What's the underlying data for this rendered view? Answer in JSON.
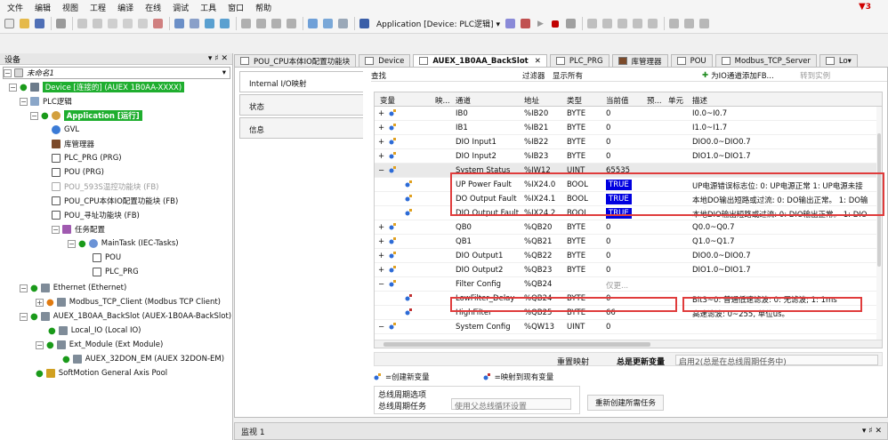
{
  "menu": [
    "文件",
    "编辑",
    "视图",
    "工程",
    "编译",
    "在线",
    "调试",
    "工具",
    "窗口",
    "帮助"
  ],
  "alarm_count": "3",
  "toolbar": {
    "app_combo": "Application [Device: PLC逻辑]"
  },
  "devices_pane": {
    "title": "设备",
    "controls": "▾ ♯ ✕",
    "project": "未命名1",
    "items": [
      {
        "label": "Device [连接的] (AUEX 1B0AA-XXXX)"
      },
      {
        "label": "PLC逻辑"
      },
      {
        "label": "Application [运行]"
      },
      {
        "label": "GVL"
      },
      {
        "label": "库管理器"
      },
      {
        "label": "PLC_PRG (PRG)"
      },
      {
        "label": "POU (PRG)"
      },
      {
        "label": "POU_593S温控功能块 (FB)"
      },
      {
        "label": "POU_CPU本体IO配置功能块 (FB)"
      },
      {
        "label": "POU_寻址功能块 (FB)"
      },
      {
        "label": "任务配置"
      },
      {
        "label": "MainTask (IEC-Tasks)"
      },
      {
        "label": "POU"
      },
      {
        "label": "PLC_PRG"
      },
      {
        "label": "Ethernet (Ethernet)"
      },
      {
        "label": "Modbus_TCP_Client (Modbus TCP Client)"
      },
      {
        "label": "AUEX_1B0AA_BackSlot (AUEX-1B0AA-BackSlot)"
      },
      {
        "label": "Local_IO (Local IO)"
      },
      {
        "label": "Ext_Module (Ext Module)"
      },
      {
        "label": "AUEX_32DON_EM (AUEX 32DON-EM)"
      },
      {
        "label": "SoftMotion General Axis Pool"
      }
    ]
  },
  "tabs": [
    "POU_CPU本体IO配置功能块",
    "Device",
    "AUEX_1B0AA_BackSlot",
    "PLC_PRG",
    "库管理器",
    "POU",
    "Modbus_TCP_Server",
    "Lo▾"
  ],
  "tab_close": "✕",
  "side_tabs": [
    "Internal I/O映射",
    "状态",
    "信息"
  ],
  "filter": {
    "find_label": "查找",
    "filter_label": "过滤器",
    "filter_value": "显示所有",
    "add_fb": "为IO通道添加FB...",
    "goto_instance": "转到实例"
  },
  "columns": [
    "变量",
    "映...",
    "通道",
    "地址",
    "类型",
    "当前值",
    "预...",
    "单元",
    "描述"
  ],
  "rows": [
    {
      "expander": "+",
      "channel": "IB0",
      "address": "%IB20",
      "type": "BYTE",
      "value": "0",
      "desc": "I0.0~I0.7"
    },
    {
      "expander": "+",
      "channel": "IB1",
      "address": "%IB21",
      "type": "BYTE",
      "value": "0",
      "desc": "I1.0~I1.7"
    },
    {
      "expander": "+",
      "channel": "DIO Input1",
      "address": "%IB22",
      "type": "BYTE",
      "value": "0",
      "desc": "DIO0.0~DIO0.7"
    },
    {
      "expander": "+",
      "channel": "DIO Input2",
      "address": "%IB23",
      "type": "BYTE",
      "value": "0",
      "desc": "DIO1.0~DIO1.7"
    },
    {
      "expander": "−",
      "channel": "System Status",
      "address": "%IW12",
      "type": "UINT",
      "value": "65535",
      "desc": ""
    },
    {
      "expander": "",
      "channel": "UP Power Fault",
      "address": "%IX24.0",
      "type": "BOOL",
      "value": "TRUE",
      "desc": "UP电源错误标志位:  0: UP电源正常 1: UP电源未接"
    },
    {
      "expander": "",
      "channel": "DO Output Fault",
      "address": "%IX24.1",
      "type": "BOOL",
      "value": "TRUE",
      "desc": "本地DO输出短路或过流:  0: DO输出正常。 1: DO输"
    },
    {
      "expander": "",
      "channel": "DIO Output Fault",
      "address": "%IX24.2",
      "type": "BOOL",
      "value": "TRUE",
      "desc": "本地DIO输出短路或过流:  0: DIO输出正常。 1: DIO"
    },
    {
      "expander": "+",
      "channel": "QB0",
      "address": "%QB20",
      "type": "BYTE",
      "value": "0",
      "desc": "Q0.0~Q0.7"
    },
    {
      "expander": "+",
      "channel": "QB1",
      "address": "%QB21",
      "type": "BYTE",
      "value": "0",
      "desc": "Q1.0~Q1.7"
    },
    {
      "expander": "+",
      "channel": "DIO Output1",
      "address": "%QB22",
      "type": "BYTE",
      "value": "0",
      "desc": "DIO0.0~DIO0.7"
    },
    {
      "expander": "+",
      "channel": "DIO Output2",
      "address": "%QB23",
      "type": "BYTE",
      "value": "0",
      "desc": "DIO1.0~DIO1.7"
    },
    {
      "expander": "−",
      "channel": "Filter Config",
      "address": "%QB24",
      "type": "",
      "value": "仅更...",
      "desc": ""
    },
    {
      "expander": "",
      "channel": "LowFilter_Delay",
      "address": "%QB24",
      "type": "BYTE",
      "value": "0",
      "desc": "Bit3~0: 普通低速滤波:  0: 无滤波;   1: 1ms"
    },
    {
      "expander": "",
      "channel": "HighFilter",
      "address": "%QB25",
      "type": "BYTE",
      "value": "66",
      "desc": "高速滤波: 0~255, 单位us。"
    },
    {
      "expander": "−",
      "channel": "System Config",
      "address": "%QW13",
      "type": "UINT",
      "value": "0",
      "desc": ""
    }
  ],
  "bottom": {
    "remap": "重置映射",
    "always_update": "总是更新变量",
    "always_update_value": "启用2(总是在总线周期任务中)",
    "legend_new": "=创建新变量",
    "legend_map": "=映射到现有变量",
    "bus_cycle_title": "总线周期选项",
    "bus_cycle_task": "总线周期任务",
    "bus_cycle_value": "使用父总线循环设置",
    "recreate": "重新创建所需任务"
  },
  "monitor": {
    "title": "监视 1",
    "controls": "▾ ♯ ✕"
  },
  "colors": {
    "accent_green": "#1fae2f",
    "true_blue": "#0000e0",
    "highlight_red": "#e03c3c"
  }
}
